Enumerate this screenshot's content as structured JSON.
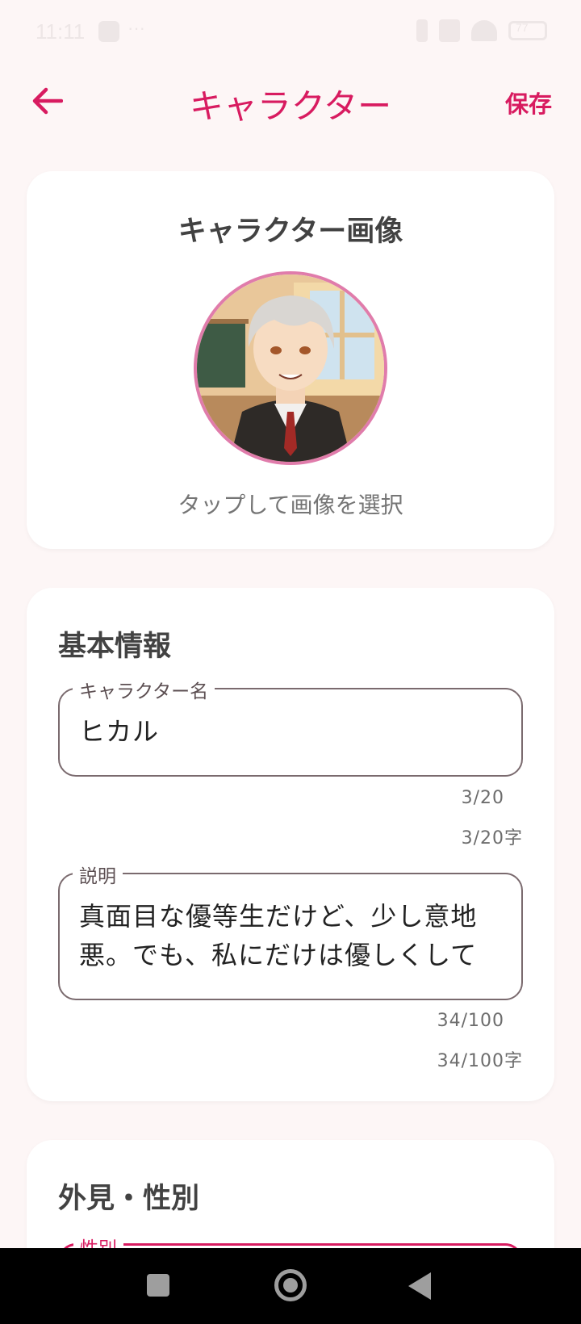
{
  "status_bar": {
    "time": "11:11",
    "extra": "···",
    "battery": "77"
  },
  "app_bar": {
    "title": "キャラクター",
    "save_label": "保存"
  },
  "image_card": {
    "title": "キャラクター画像",
    "hint": "タップして画像を選択"
  },
  "basic_info": {
    "title": "基本情報",
    "name_field": {
      "label": "キャラクター名",
      "value": "ヒカル",
      "counter": "3/20",
      "helper": "3/20字"
    },
    "description_field": {
      "label": "説明",
      "value_line1": "真面目な優等生だけど、少し意地",
      "value_line2": "悪。でも、私にだけは優しくして",
      "counter": "34/100",
      "helper": "34/100字"
    }
  },
  "appearance": {
    "title": "外見・性別",
    "gender_label": "性別"
  },
  "colors": {
    "accent": "#D81B60",
    "background": "#FDF6F6"
  }
}
